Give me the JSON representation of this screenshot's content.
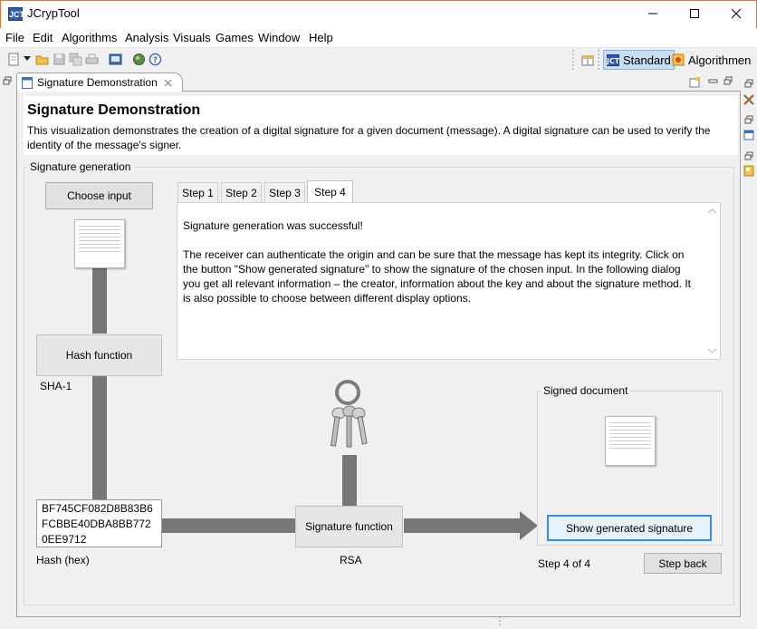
{
  "window": {
    "title": "JCrypTool",
    "icon_label": "JCT"
  },
  "menu": [
    "File",
    "Edit",
    "Algorithms",
    "Analysis",
    "Visuals",
    "Games",
    "Window",
    "Help"
  ],
  "toolbar": {
    "icons": [
      "new-icon",
      "open-folder-icon",
      "save-icon",
      "save-all-icon",
      "print-icon",
      "console-icon",
      "web-icon",
      "help-icon"
    ],
    "perspectives": [
      {
        "label": "Standard",
        "active": true
      },
      {
        "label": "Algorithmen",
        "active": false
      }
    ]
  },
  "editor_tab": {
    "label": "Signature Demonstration"
  },
  "header": {
    "title": "Signature Demonstration",
    "description": "This visualization demonstrates the creation of a digital signature for a given document (message). A digital signature can be used to verify the identity of the message's signer."
  },
  "group": {
    "label": "Signature generation"
  },
  "choose_input": {
    "label": "Choose input"
  },
  "hash_function": {
    "label": "Hash function",
    "algorithm": "SHA-1"
  },
  "tabs": [
    {
      "label": "Step 1",
      "active": false
    },
    {
      "label": "Step 2",
      "active": false
    },
    {
      "label": "Step 3",
      "active": false
    },
    {
      "label": "Step 4",
      "active": true
    }
  ],
  "tab_content": {
    "line1": "Signature generation was successful!",
    "para": "The receiver can authenticate the origin and can be sure that the message has kept its integrity. Click on the button \"Show generated signature\" to show the signature of the chosen input. In the following dialog you get all relevant information – the creator, information about the key and about the signature method. It is also possible to choose between different display options."
  },
  "hash_value": {
    "text": "BF745CF082D8B83B6FCBBE40DBA8BB7720EE9712",
    "label": "Hash (hex)"
  },
  "signature_function": {
    "label": "Signature function",
    "algorithm": "RSA"
  },
  "signed_document": {
    "label": "Signed document",
    "button": "Show generated signature"
  },
  "footer": {
    "step_status": "Step 4 of 4",
    "step_back": "Step back"
  },
  "colors": {
    "accent_border": "#e8733a",
    "focus_blue": "#3c8ad8",
    "pipe_gray": "#777777"
  }
}
